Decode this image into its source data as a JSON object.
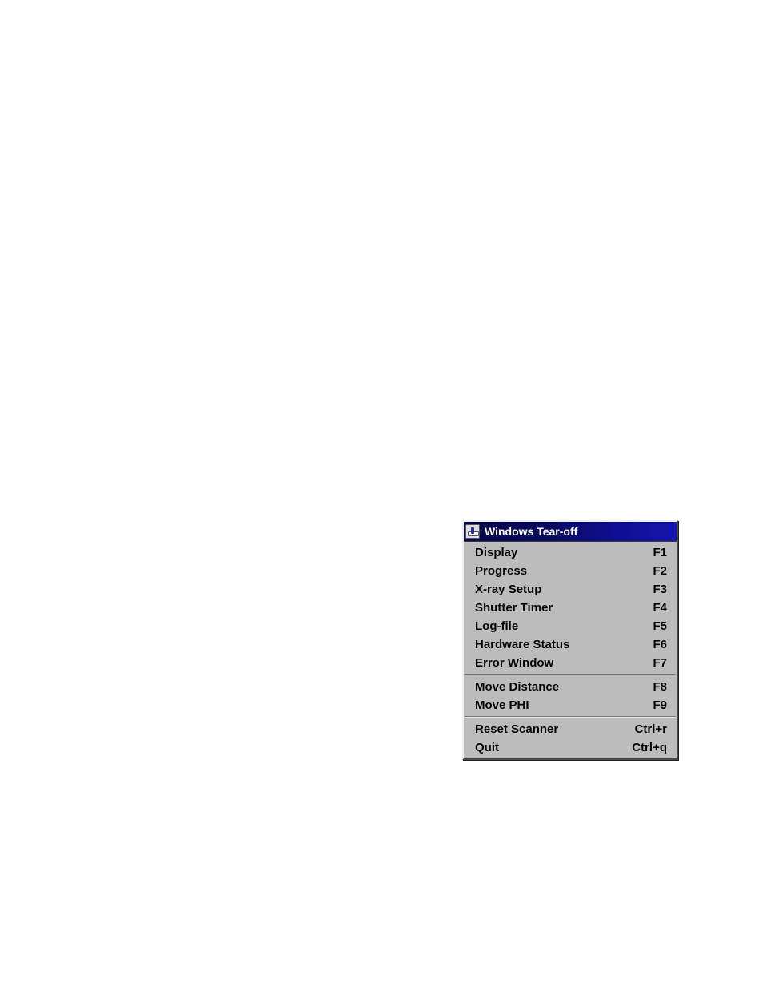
{
  "window": {
    "title": "Windows Tear-off",
    "groups": [
      {
        "items": [
          {
            "label": "Display",
            "accel": "F1"
          },
          {
            "label": "Progress",
            "accel": "F2"
          },
          {
            "label": "X-ray Setup",
            "accel": "F3"
          },
          {
            "label": "Shutter Timer",
            "accel": "F4"
          },
          {
            "label": "Log-file",
            "accel": "F5"
          },
          {
            "label": "Hardware Status",
            "accel": "F6"
          },
          {
            "label": "Error Window",
            "accel": "F7"
          }
        ]
      },
      {
        "items": [
          {
            "label": "Move Distance",
            "accel": "F8"
          },
          {
            "label": "Move PHI",
            "accel": "F9"
          }
        ]
      },
      {
        "items": [
          {
            "label": "Reset Scanner",
            "accel": "Ctrl+r"
          },
          {
            "label": "Quit",
            "accel": "Ctrl+q"
          }
        ]
      }
    ]
  }
}
